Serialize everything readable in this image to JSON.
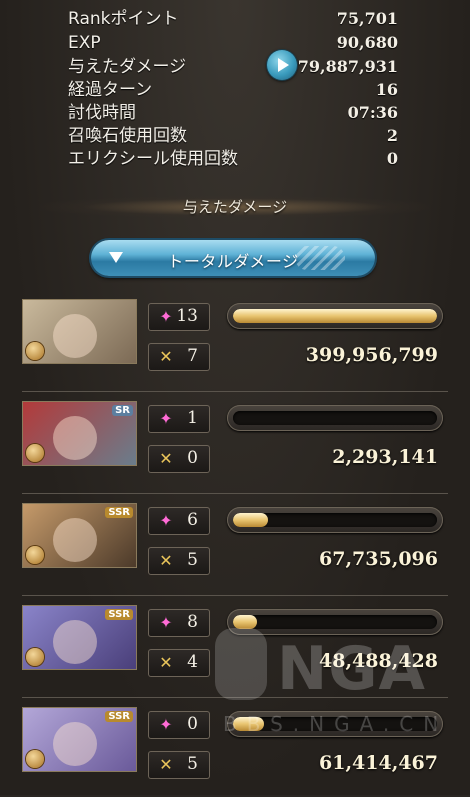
{
  "stats": [
    {
      "label": "Rankポイント",
      "value": "75,701"
    },
    {
      "label": "EXP",
      "value": "90,680"
    },
    {
      "label": "与えたダメージ",
      "value": "579,887,931"
    },
    {
      "label": "経過ターン",
      "value": "16"
    },
    {
      "label": "討伐時間",
      "value": "07:36"
    },
    {
      "label": "召喚石使用回数",
      "value": "2"
    },
    {
      "label": "エリクシール使用回数",
      "value": "0"
    }
  ],
  "section_title": "与えたダメージ",
  "total_button": "トータルダメージ",
  "characters": [
    {
      "rarity": "",
      "skill_count": "13",
      "ougi_count": "7",
      "damage": "399,956,799",
      "bar_fill": 1.0,
      "colors": [
        "#c9b99c",
        "#7c6a55"
      ]
    },
    {
      "rarity": "SR",
      "skill_count": "1",
      "ougi_count": "0",
      "damage": "2,293,141",
      "bar_fill": 0.0,
      "colors": [
        "#b33a3a",
        "#6a7d8c"
      ]
    },
    {
      "rarity": "SSR",
      "skill_count": "6",
      "ougi_count": "5",
      "damage": "67,735,096",
      "bar_fill": 0.17,
      "colors": [
        "#c59a6a",
        "#4c3a2a"
      ]
    },
    {
      "rarity": "SSR",
      "skill_count": "8",
      "ougi_count": "4",
      "damage": "48,488,428",
      "bar_fill": 0.12,
      "colors": [
        "#8a84c9",
        "#4a3f7a"
      ]
    },
    {
      "rarity": "SSR",
      "skill_count": "0",
      "ougi_count": "5",
      "damage": "61,414,467",
      "bar_fill": 0.15,
      "colors": [
        "#b3a7d8",
        "#6a5a9a"
      ]
    }
  ],
  "watermark": {
    "big": "NGA",
    "small": "BBS.NGA.CN"
  }
}
